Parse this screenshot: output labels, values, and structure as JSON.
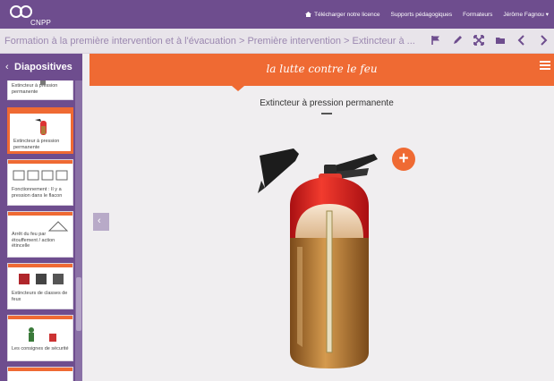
{
  "brand": {
    "name": "CNPP"
  },
  "topnav": {
    "download_label": "Télécharger notre licence",
    "supports_label": "Supports pédagogiques",
    "trainers_label": "Formateurs",
    "user_label": "Jérôme Fagnou"
  },
  "breadcrumb": {
    "text": "Formation à la première intervention et à l'évacuation > Première intervention > Extincteur à ..."
  },
  "toolbar": {
    "tools": [
      "flag-icon",
      "pencil-icon",
      "fullscreen-icon",
      "folder-icon",
      "chevron-left-icon",
      "chevron-right-icon"
    ]
  },
  "sidebar": {
    "title": "Diapositives",
    "thumbnails": [
      {
        "caption": "Extincteur à pression permanente"
      },
      {
        "caption": "Extincteur à pression permanente"
      },
      {
        "caption": "Fonctionnement : Il y a pression dans le flacon"
      },
      {
        "caption": "Arrêt du feu par étouffement / action étincelle"
      },
      {
        "caption": "Extincteurs de classes de feux"
      },
      {
        "caption": "Les consignes de sécurité"
      }
    ]
  },
  "slide": {
    "header": "la lutte contre le feu",
    "subtitle": "Extincteur à pression permanente"
  },
  "colors": {
    "purple": "#6e4d8e",
    "orange": "#ef6a33",
    "background": "#f0eef0"
  }
}
